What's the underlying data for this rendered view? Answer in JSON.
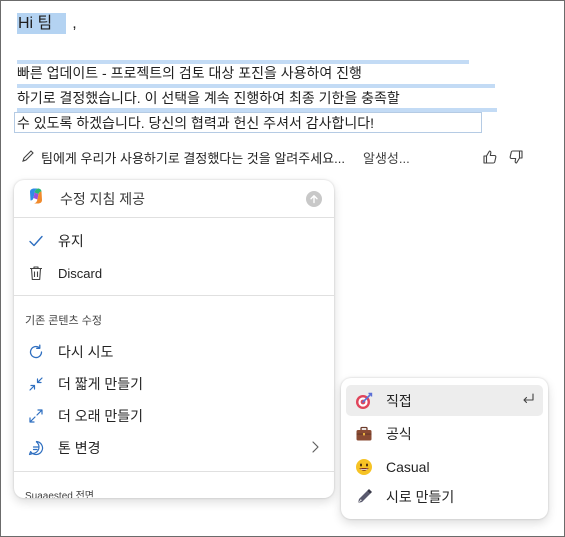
{
  "document": {
    "greeting": "Hi 팀",
    "greeting_comma": ",",
    "line1": "빠른 업데이트 - 프로젝트의 검토 대상 포진을 사용하여 진행",
    "line2": "하기로 결정했습니다. 이 선택을 계속 진행하여 최종 기한을 충족할",
    "line3": "수 있도록 하겠습니다. 당신의 협력과 헌신 주셔서 감사합니다!"
  },
  "prompt": {
    "text": "팀에게 우리가 사용하기로 결정했다는 것을 알려주세요...",
    "status": "알생성..."
  },
  "menu": {
    "title": "수정 지침 제공",
    "keep": "유지",
    "discard": "Discard",
    "section_label": "기존 콘텐츠 수정",
    "retry": "다시 시도",
    "shorter": "더 짧게 만들기",
    "longer": "더 오래 만들기",
    "tone": "톤 변경",
    "suggested": "Suaaested 전면"
  },
  "submenu": {
    "direct": "직접",
    "formal": "공식",
    "casual": "Casual",
    "poem": "시로 만들기"
  },
  "colors": {
    "selection": "#b4d3f2",
    "accent": "#2f6fc0"
  }
}
